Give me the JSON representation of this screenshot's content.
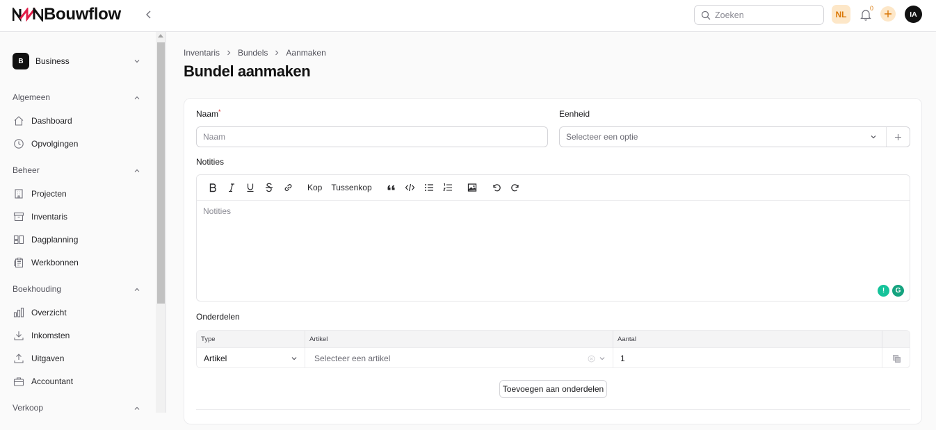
{
  "app": {
    "name": "Bouwflow"
  },
  "header": {
    "search_placeholder": "Zoeken",
    "language": "NL",
    "notification_count": "0",
    "user_initials": "IA"
  },
  "sidebar": {
    "org": {
      "badge": "B",
      "name": "Business"
    },
    "groups": [
      {
        "label": "Algemeen",
        "items": [
          {
            "label": "Dashboard",
            "icon": "home-icon"
          },
          {
            "label": "Opvolgingen",
            "icon": "clock-icon"
          }
        ]
      },
      {
        "label": "Beheer",
        "items": [
          {
            "label": "Projecten",
            "icon": "building-icon"
          },
          {
            "label": "Inventaris",
            "icon": "archive-icon"
          },
          {
            "label": "Dagplanning",
            "icon": "calendar-layout-icon"
          },
          {
            "label": "Werkbonnen",
            "icon": "clipboard-icon"
          }
        ]
      },
      {
        "label": "Boekhouding",
        "items": [
          {
            "label": "Overzicht",
            "icon": "bar-chart-icon"
          },
          {
            "label": "Inkomsten",
            "icon": "download-icon"
          },
          {
            "label": "Uitgaven",
            "icon": "upload-icon"
          },
          {
            "label": "Accountant",
            "icon": "briefcase-icon"
          }
        ]
      },
      {
        "label": "Verkoop",
        "items": []
      }
    ]
  },
  "breadcrumb": [
    "Inventaris",
    "Bundels",
    "Aanmaken"
  ],
  "page": {
    "title": "Bundel aanmaken"
  },
  "form": {
    "naam_label": "Naam",
    "naam_required": "*",
    "naam_placeholder": "Naam",
    "eenheid_label": "Eenheid",
    "eenheid_placeholder": "Selecteer een optie",
    "notities_label": "Notities",
    "notities_placeholder": "Notities",
    "toolbar": {
      "heading": "Kop",
      "subheading": "Tussenkop"
    },
    "onderdelen_label": "Onderdelen",
    "table": {
      "headers": [
        "Type",
        "Artikel",
        "Aantal"
      ],
      "row": {
        "type": "Artikel",
        "artikel_placeholder": "Selecteer een artikel",
        "aantal": "1"
      }
    },
    "add_part_label": "Toevoegen aan onderdelen"
  },
  "colors": {
    "accent": "#d97706",
    "accent_bg": "#fde7c8",
    "required": "#dc2626"
  }
}
